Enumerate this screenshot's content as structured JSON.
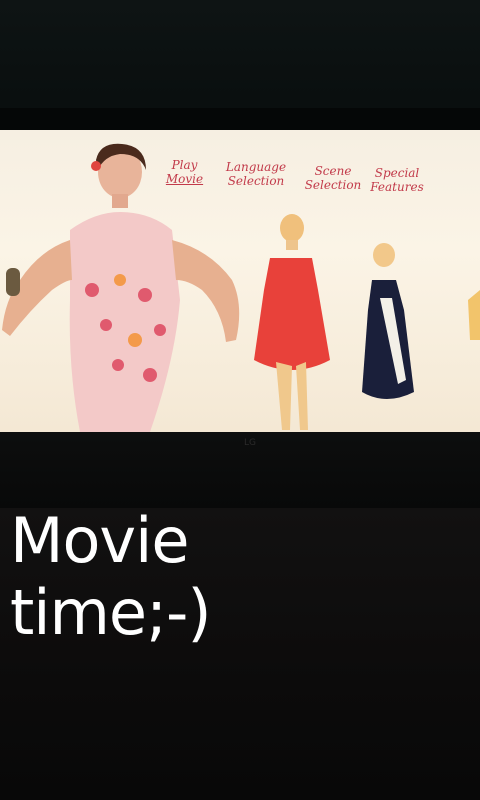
{
  "tv_menu": {
    "items": [
      {
        "line1": "Play",
        "line2": "Movie"
      },
      {
        "line1": "Language",
        "line2": "Selection"
      },
      {
        "line1": "Scene",
        "line2": "Selection"
      },
      {
        "line1": "Special",
        "line2": "Features"
      }
    ]
  },
  "tv_brand": "LG",
  "caption": {
    "line1": "Movie",
    "line2": "time;-)"
  },
  "colors": {
    "menu_text": "#c23a4a",
    "screen_bg": "#f6efe2",
    "caption_text": "#ffffff"
  }
}
